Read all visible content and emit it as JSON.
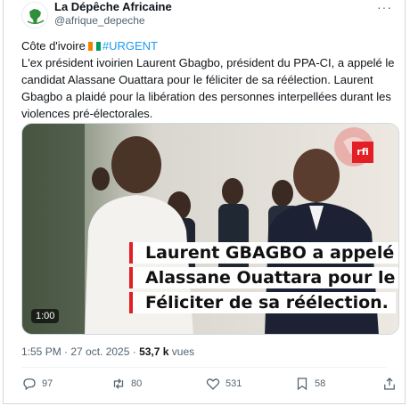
{
  "author": {
    "name": "La Dépêche Africaine",
    "handle": "@afrique_depeche",
    "more_label": "···"
  },
  "tweet": {
    "location": "Côte d'ivoire",
    "flag_colors": [
      "#f77f00",
      "#ffffff",
      "#009e60"
    ],
    "hashtag": "#URGENT",
    "body": "L'ex président ivoirien Laurent Gbagbo, président du PPA-CI, a appelé le candidat Alassane Ouattara pour le féliciter de sa réélection. Laurent Gbagbo a plaidé pour la libération des personnes interpellées durant les violences pré-électorales."
  },
  "media": {
    "duration": "1:00",
    "logo_text": "rfi",
    "caption_lines": [
      "Laurent GBAGBO a appelé",
      "Alassane Ouattara pour le",
      "Féliciter de sa réélection."
    ],
    "accent_color": "#e31e24"
  },
  "meta": {
    "time": "1:55 PM · 27 oct. 2025 · ",
    "views_count": "53,7 k",
    "views_label": " vues"
  },
  "actions": {
    "replies": "97",
    "reposts": "80",
    "likes": "531",
    "bookmarks": "58"
  },
  "colors": {
    "link": "#1d9bf0",
    "muted": "#536471",
    "text": "#0f1419"
  }
}
